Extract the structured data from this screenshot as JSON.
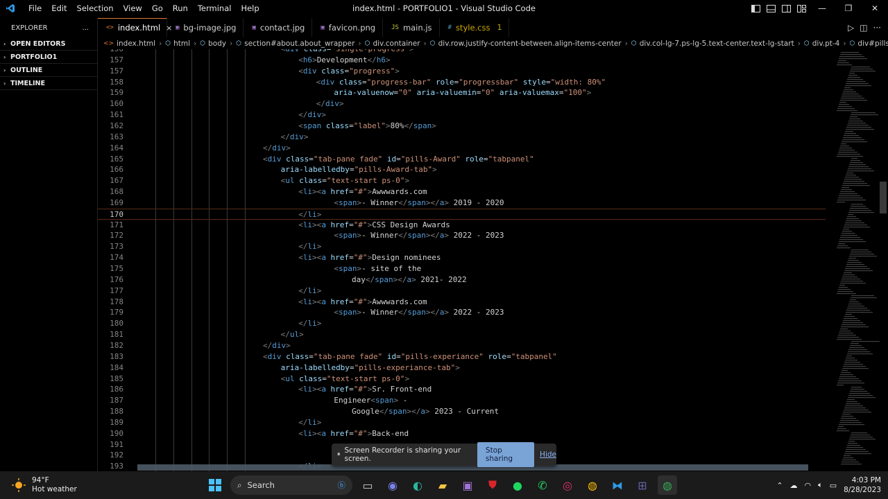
{
  "titlebar": {
    "menu": [
      "File",
      "Edit",
      "Selection",
      "View",
      "Go",
      "Run",
      "Terminal",
      "Help"
    ],
    "title": "index.html - PORTFOLIO1 - Visual Studio Code"
  },
  "sidebar": {
    "title": "EXPLORER",
    "more": "...",
    "sections": [
      "OPEN EDITORS",
      "PORTFOLIO1",
      "OUTLINE",
      "TIMELINE"
    ]
  },
  "tabs": [
    {
      "label": "index.html",
      "icon": "<>",
      "icon_color": "#e37933",
      "active": true,
      "close": "×"
    },
    {
      "label": "bg-image.jpg",
      "icon": "▣",
      "icon_color": "#a074c4"
    },
    {
      "label": "contact.jpg",
      "icon": "▣",
      "icon_color": "#a074c4"
    },
    {
      "label": "favicon.png",
      "icon": "▣",
      "icon_color": "#a074c4"
    },
    {
      "label": "main.js",
      "icon": "JS",
      "icon_color": "#cbcb41"
    },
    {
      "label": "style.css",
      "icon": "#",
      "icon_color": "#519aba",
      "badge": "1"
    }
  ],
  "breadcrumbs": [
    "index.html",
    "html",
    "body",
    "section#about.about_wrapper",
    "div.container",
    "div.row.justify-content-between.align-items-center",
    "div.col-lg-7.ps-lg-5.text-center.text-lg-start",
    "div.pt-4",
    "div#pills-tabContent"
  ],
  "editor": {
    "current_line": 170,
    "lines": [
      {
        "n": 156,
        "indent": 8,
        "tokens": [
          [
            "p",
            "<"
          ],
          [
            "t",
            "div"
          ],
          [
            "a",
            " class"
          ],
          [
            "x",
            "="
          ],
          [
            "s",
            "\"single-progress\""
          ],
          [
            "p",
            ">"
          ]
        ]
      },
      {
        "n": 157,
        "indent": 9,
        "tokens": [
          [
            "p",
            "<"
          ],
          [
            "t",
            "h6"
          ],
          [
            "p",
            ">"
          ],
          [
            "x",
            "Development"
          ],
          [
            "p",
            "</"
          ],
          [
            "t",
            "h6"
          ],
          [
            "p",
            ">"
          ]
        ]
      },
      {
        "n": 157,
        "indent": 9,
        "tokens": [
          [
            "p",
            "<"
          ],
          [
            "t",
            "div"
          ],
          [
            "a",
            " class"
          ],
          [
            "x",
            "="
          ],
          [
            "s",
            "\"progress\""
          ],
          [
            "p",
            ">"
          ]
        ]
      },
      {
        "n": 158,
        "indent": 10,
        "tokens": [
          [
            "p",
            "<"
          ],
          [
            "t",
            "div"
          ],
          [
            "a",
            " class"
          ],
          [
            "x",
            "="
          ],
          [
            "s",
            "\"progress-bar\""
          ],
          [
            "a",
            " role"
          ],
          [
            "x",
            "="
          ],
          [
            "s",
            "\"progressbar\""
          ],
          [
            "a",
            " style"
          ],
          [
            "x",
            "="
          ],
          [
            "s",
            "\"width: 80%\""
          ]
        ]
      },
      {
        "n": 159,
        "indent": 11,
        "tokens": [
          [
            "a",
            "aria-valuenow"
          ],
          [
            "x",
            "="
          ],
          [
            "s",
            "\"0\""
          ],
          [
            "a",
            " aria-valuemin"
          ],
          [
            "x",
            "="
          ],
          [
            "s",
            "\"0\""
          ],
          [
            "a",
            " aria-valuemax"
          ],
          [
            "x",
            "="
          ],
          [
            "s",
            "\"100\""
          ],
          [
            "p",
            ">"
          ]
        ]
      },
      {
        "n": 160,
        "indent": 10,
        "tokens": [
          [
            "p",
            "</"
          ],
          [
            "t",
            "div"
          ],
          [
            "p",
            ">"
          ]
        ]
      },
      {
        "n": 161,
        "indent": 9,
        "tokens": [
          [
            "p",
            "</"
          ],
          [
            "t",
            "div"
          ],
          [
            "p",
            ">"
          ]
        ]
      },
      {
        "n": 162,
        "indent": 9,
        "tokens": [
          [
            "p",
            "<"
          ],
          [
            "t",
            "span"
          ],
          [
            "a",
            " class"
          ],
          [
            "x",
            "="
          ],
          [
            "s",
            "\"label\""
          ],
          [
            "p",
            ">"
          ],
          [
            "x",
            "80%"
          ],
          [
            "p",
            "</"
          ],
          [
            "t",
            "span"
          ],
          [
            "p",
            ">"
          ]
        ]
      },
      {
        "n": 163,
        "indent": 8,
        "tokens": [
          [
            "p",
            "</"
          ],
          [
            "t",
            "div"
          ],
          [
            "p",
            ">"
          ]
        ]
      },
      {
        "n": 164,
        "indent": 7,
        "tokens": [
          [
            "p",
            "</"
          ],
          [
            "t",
            "div"
          ],
          [
            "p",
            ">"
          ]
        ]
      },
      {
        "n": 165,
        "indent": 7,
        "tokens": [
          [
            "p",
            "<"
          ],
          [
            "t",
            "div"
          ],
          [
            "a",
            " class"
          ],
          [
            "x",
            "="
          ],
          [
            "s",
            "\"tab-pane fade\""
          ],
          [
            "a",
            " id"
          ],
          [
            "x",
            "="
          ],
          [
            "s",
            "\"pills-Award\""
          ],
          [
            "a",
            " role"
          ],
          [
            "x",
            "="
          ],
          [
            "s",
            "\"tabpanel\""
          ]
        ]
      },
      {
        "n": 166,
        "indent": 8,
        "tokens": [
          [
            "a",
            "aria-labelledby"
          ],
          [
            "x",
            "="
          ],
          [
            "s",
            "\"pills-Award-tab\""
          ],
          [
            "p",
            ">"
          ]
        ]
      },
      {
        "n": 167,
        "indent": 8,
        "tokens": [
          [
            "p",
            "<"
          ],
          [
            "t",
            "ul"
          ],
          [
            "a",
            " class"
          ],
          [
            "x",
            "="
          ],
          [
            "s",
            "\"text-start ps-0\""
          ],
          [
            "p",
            ">"
          ]
        ]
      },
      {
        "n": 168,
        "indent": 9,
        "tokens": [
          [
            "p",
            "<"
          ],
          [
            "t",
            "li"
          ],
          [
            "p",
            "><"
          ],
          [
            "t",
            "a"
          ],
          [
            "a",
            " href"
          ],
          [
            "x",
            "="
          ],
          [
            "s",
            "\"#\""
          ],
          [
            "p",
            ">"
          ],
          [
            "x",
            "Awwwards.com"
          ]
        ]
      },
      {
        "n": 169,
        "indent": 11,
        "tokens": [
          [
            "p",
            "<"
          ],
          [
            "t",
            "span"
          ],
          [
            "p",
            ">"
          ],
          [
            "x",
            "- Winner"
          ],
          [
            "p",
            "</"
          ],
          [
            "t",
            "span"
          ],
          [
            "p",
            "></"
          ],
          [
            "t",
            "a"
          ],
          [
            "p",
            ">"
          ],
          [
            "x",
            " 2019 - 2020"
          ]
        ]
      },
      {
        "n": 170,
        "indent": 9,
        "tokens": [
          [
            "p",
            "</"
          ],
          [
            "t",
            "li"
          ],
          [
            "p",
            ">"
          ]
        ]
      },
      {
        "n": 171,
        "indent": 9,
        "tokens": [
          [
            "p",
            "<"
          ],
          [
            "t",
            "li"
          ],
          [
            "p",
            "><"
          ],
          [
            "t",
            "a"
          ],
          [
            "a",
            " href"
          ],
          [
            "x",
            "="
          ],
          [
            "s",
            "\"#\""
          ],
          [
            "p",
            ">"
          ],
          [
            "x",
            "CSS Design Awards"
          ]
        ]
      },
      {
        "n": 172,
        "indent": 11,
        "tokens": [
          [
            "p",
            "<"
          ],
          [
            "t",
            "span"
          ],
          [
            "p",
            ">"
          ],
          [
            "x",
            "- Winner"
          ],
          [
            "p",
            "</"
          ],
          [
            "t",
            "span"
          ],
          [
            "p",
            "></"
          ],
          [
            "t",
            "a"
          ],
          [
            "p",
            ">"
          ],
          [
            "x",
            " 2022 - 2023"
          ]
        ]
      },
      {
        "n": 173,
        "indent": 9,
        "tokens": [
          [
            "p",
            "</"
          ],
          [
            "t",
            "li"
          ],
          [
            "p",
            ">"
          ]
        ]
      },
      {
        "n": 174,
        "indent": 9,
        "tokens": [
          [
            "p",
            "<"
          ],
          [
            "t",
            "li"
          ],
          [
            "p",
            "><"
          ],
          [
            "t",
            "a"
          ],
          [
            "a",
            " href"
          ],
          [
            "x",
            "="
          ],
          [
            "s",
            "\"#\""
          ],
          [
            "p",
            ">"
          ],
          [
            "x",
            "Design nominees"
          ]
        ]
      },
      {
        "n": 175,
        "indent": 11,
        "tokens": [
          [
            "p",
            "<"
          ],
          [
            "t",
            "span"
          ],
          [
            "p",
            ">"
          ],
          [
            "x",
            "- site of the"
          ]
        ]
      },
      {
        "n": 176,
        "indent": 12,
        "tokens": [
          [
            "x",
            "day"
          ],
          [
            "p",
            "</"
          ],
          [
            "t",
            "span"
          ],
          [
            "p",
            "></"
          ],
          [
            "t",
            "a"
          ],
          [
            "p",
            ">"
          ],
          [
            "x",
            " 2021- 2022"
          ]
        ]
      },
      {
        "n": 177,
        "indent": 9,
        "tokens": [
          [
            "p",
            "</"
          ],
          [
            "t",
            "li"
          ],
          [
            "p",
            ">"
          ]
        ]
      },
      {
        "n": 178,
        "indent": 9,
        "tokens": [
          [
            "p",
            "<"
          ],
          [
            "t",
            "li"
          ],
          [
            "p",
            "><"
          ],
          [
            "t",
            "a"
          ],
          [
            "a",
            " href"
          ],
          [
            "x",
            "="
          ],
          [
            "s",
            "\"#\""
          ],
          [
            "p",
            ">"
          ],
          [
            "x",
            "Awwwards.com"
          ]
        ]
      },
      {
        "n": 179,
        "indent": 11,
        "tokens": [
          [
            "p",
            "<"
          ],
          [
            "t",
            "span"
          ],
          [
            "p",
            ">"
          ],
          [
            "x",
            "- Winner"
          ],
          [
            "p",
            "</"
          ],
          [
            "t",
            "span"
          ],
          [
            "p",
            "></"
          ],
          [
            "t",
            "a"
          ],
          [
            "p",
            ">"
          ],
          [
            "x",
            " 2022 - 2023"
          ]
        ]
      },
      {
        "n": 180,
        "indent": 9,
        "tokens": [
          [
            "p",
            "</"
          ],
          [
            "t",
            "li"
          ],
          [
            "p",
            ">"
          ]
        ]
      },
      {
        "n": 181,
        "indent": 8,
        "tokens": [
          [
            "p",
            "</"
          ],
          [
            "t",
            "ul"
          ],
          [
            "p",
            ">"
          ]
        ]
      },
      {
        "n": 182,
        "indent": 7,
        "tokens": [
          [
            "p",
            "</"
          ],
          [
            "t",
            "div"
          ],
          [
            "p",
            ">"
          ]
        ]
      },
      {
        "n": 183,
        "indent": 7,
        "tokens": [
          [
            "p",
            "<"
          ],
          [
            "t",
            "div"
          ],
          [
            "a",
            " class"
          ],
          [
            "x",
            "="
          ],
          [
            "s",
            "\"tab-pane fade\""
          ],
          [
            "a",
            " id"
          ],
          [
            "x",
            "="
          ],
          [
            "s",
            "\"pills-experiance\""
          ],
          [
            "a",
            " role"
          ],
          [
            "x",
            "="
          ],
          [
            "s",
            "\"tabpanel\""
          ]
        ]
      },
      {
        "n": 184,
        "indent": 8,
        "tokens": [
          [
            "a",
            "aria-labelledby"
          ],
          [
            "x",
            "="
          ],
          [
            "s",
            "\"pills-experiance-tab\""
          ],
          [
            "p",
            ">"
          ]
        ]
      },
      {
        "n": 185,
        "indent": 8,
        "tokens": [
          [
            "p",
            "<"
          ],
          [
            "t",
            "ul"
          ],
          [
            "a",
            " class"
          ],
          [
            "x",
            "="
          ],
          [
            "s",
            "\"text-start ps-0\""
          ],
          [
            "p",
            ">"
          ]
        ]
      },
      {
        "n": 186,
        "indent": 9,
        "tokens": [
          [
            "p",
            "<"
          ],
          [
            "t",
            "li"
          ],
          [
            "p",
            "><"
          ],
          [
            "t",
            "a"
          ],
          [
            "a",
            " href"
          ],
          [
            "x",
            "="
          ],
          [
            "s",
            "\"#\""
          ],
          [
            "p",
            ">"
          ],
          [
            "x",
            "Sr. Front-end"
          ]
        ]
      },
      {
        "n": 187,
        "indent": 11,
        "tokens": [
          [
            "x",
            "Engineer"
          ],
          [
            "p",
            "<"
          ],
          [
            "t",
            "span"
          ],
          [
            "p",
            ">"
          ],
          [
            "x",
            " -"
          ]
        ]
      },
      {
        "n": 188,
        "indent": 12,
        "tokens": [
          [
            "x",
            "Google"
          ],
          [
            "p",
            "</"
          ],
          [
            "t",
            "span"
          ],
          [
            "p",
            "></"
          ],
          [
            "t",
            "a"
          ],
          [
            "p",
            ">"
          ],
          [
            "x",
            " 2023 - Current"
          ]
        ]
      },
      {
        "n": 189,
        "indent": 9,
        "tokens": [
          [
            "p",
            "</"
          ],
          [
            "t",
            "li"
          ],
          [
            "p",
            ">"
          ]
        ]
      },
      {
        "n": 190,
        "indent": 9,
        "tokens": [
          [
            "p",
            "<"
          ],
          [
            "t",
            "li"
          ],
          [
            "p",
            "><"
          ],
          [
            "t",
            "a"
          ],
          [
            "a",
            " href"
          ],
          [
            "x",
            "="
          ],
          [
            "s",
            "\"#\""
          ],
          [
            "p",
            ">"
          ],
          [
            "x",
            "Back-end"
          ]
        ]
      },
      {
        "n": 191,
        "indent": 11,
        "tokens": []
      },
      {
        "n": 192,
        "indent": 11,
        "tokens": []
      },
      {
        "n": 193,
        "indent": 9,
        "tokens": [
          [
            "p",
            "</"
          ],
          [
            "t",
            "li"
          ],
          [
            "p",
            ">"
          ]
        ]
      }
    ]
  },
  "share_bar": {
    "pause": "⏸",
    "message": "Screen Recorder is sharing your screen.",
    "stop": "Stop sharing",
    "hide": "Hide"
  },
  "taskbar": {
    "temperature": "94°F",
    "weather": "Hot weather",
    "search": "Search",
    "time": "4:03 PM",
    "date": "8/28/2023"
  }
}
